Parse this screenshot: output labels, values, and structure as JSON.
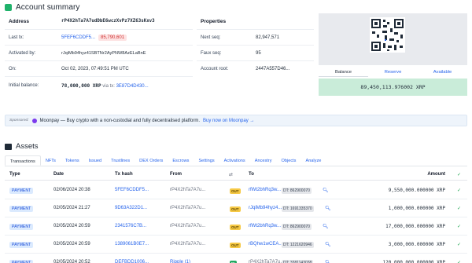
{
  "account_summary": {
    "title": "Account summary",
    "address_label": "Address",
    "address": "rP4X2hTa7A7udDbE6wczXvPz7XZ63sKxv3",
    "last_tx_label": "Last tx:",
    "last_tx_hash": "5FEF6CDDF5...",
    "last_tx_ledger": "85,790,601",
    "activated_by_label": "Activated by:",
    "activated_by": "rJqiMb94hyz41SBTNr2AyPNW8AzELaBnE",
    "on_label": "On:",
    "on_value": "Oct 02, 2023, 07:49:51 PM UTC",
    "initial_balance_label": "Initial balance:",
    "initial_balance": "78,000,000 XRP",
    "via_tx_label": "via tx:",
    "via_tx": "3E87D4D430..."
  },
  "properties": {
    "title": "Properties",
    "next_seq_label": "Next seq:",
    "next_seq": "82,947,571",
    "faux_seq_label": "Faux seq:",
    "faux_seq": "95",
    "account_root_label": "Account root:",
    "account_root": "2447A557D46..."
  },
  "balance": {
    "tabs": [
      "Balance",
      "Reserve",
      "Available"
    ],
    "value": "89,450,113.976002 XRP"
  },
  "sponsor": {
    "tag": "Sponsored:",
    "text": "Moonpay — Buy crypto with a non-custodial and fully decentralised platform.",
    "cta": "Buy now on Moonpay →"
  },
  "assets": {
    "title": "Assets",
    "tabs": [
      "Transactions",
      "NFTs",
      "Tokens",
      "Issued",
      "Trustlines",
      "DEX Orders",
      "Escrows",
      "Settings",
      "Activations",
      "Ancestry",
      "Objects",
      "Analyze"
    ],
    "columns": {
      "type": "Type",
      "date": "Date",
      "hash": "Tx hash",
      "from": "From",
      "dir": "⇄",
      "to": "To",
      "amount": "Amount",
      "status": "✓"
    },
    "rows": [
      {
        "type": "PAYMENT",
        "date": "02/06/2024 20:38",
        "hash": "5FEF6CDDF5...",
        "from": "rP4X2hTa7A7u...",
        "dir": "OUT",
        "to": "rfWt2bhRq3w...",
        "dt": "DT: 862900070",
        "amount": "9,550,000.000000 XRP",
        "status": "✓"
      },
      {
        "type": "PAYMENT",
        "date": "02/05/2024 21:27",
        "hash": "9D63A322D1...",
        "from": "rP4X2hTa7A7u...",
        "dir": "OUT",
        "to": "rJqiMb94hyz4...",
        "dt": "DT: 1691335370",
        "amount": "1,000,000.000000 XRP",
        "status": "✓"
      },
      {
        "type": "PAYMENT",
        "date": "02/05/2024 20:59",
        "hash": "2341576C7B...",
        "from": "rP4X2hTa7A7u...",
        "dir": "OUT",
        "to": "rfWt2bhRq3w...",
        "dt": "DT: 862900070",
        "amount": "17,000,000.000000 XRP",
        "status": "✓"
      },
      {
        "type": "PAYMENT",
        "date": "02/05/2024 20:59",
        "hash": "1389061B0E7...",
        "from": "rP4X2hTa7A7u...",
        "dir": "OUT",
        "to": "rBQhw1wCEA...",
        "dt": "DT: 1221620946",
        "amount": "3,000,000.000000 XRP",
        "status": "✓"
      },
      {
        "type": "PAYMENT",
        "date": "02/05/2024 20:52",
        "hash": "DEFBDD1006...",
        "from": "Ripple (1)",
        "dir": "IN",
        "to": "rP4X2hTa7A7u...",
        "dt": "DT: 3381143038",
        "amount": "120,000,000.000000 XRP",
        "status": "✓"
      }
    ]
  }
}
